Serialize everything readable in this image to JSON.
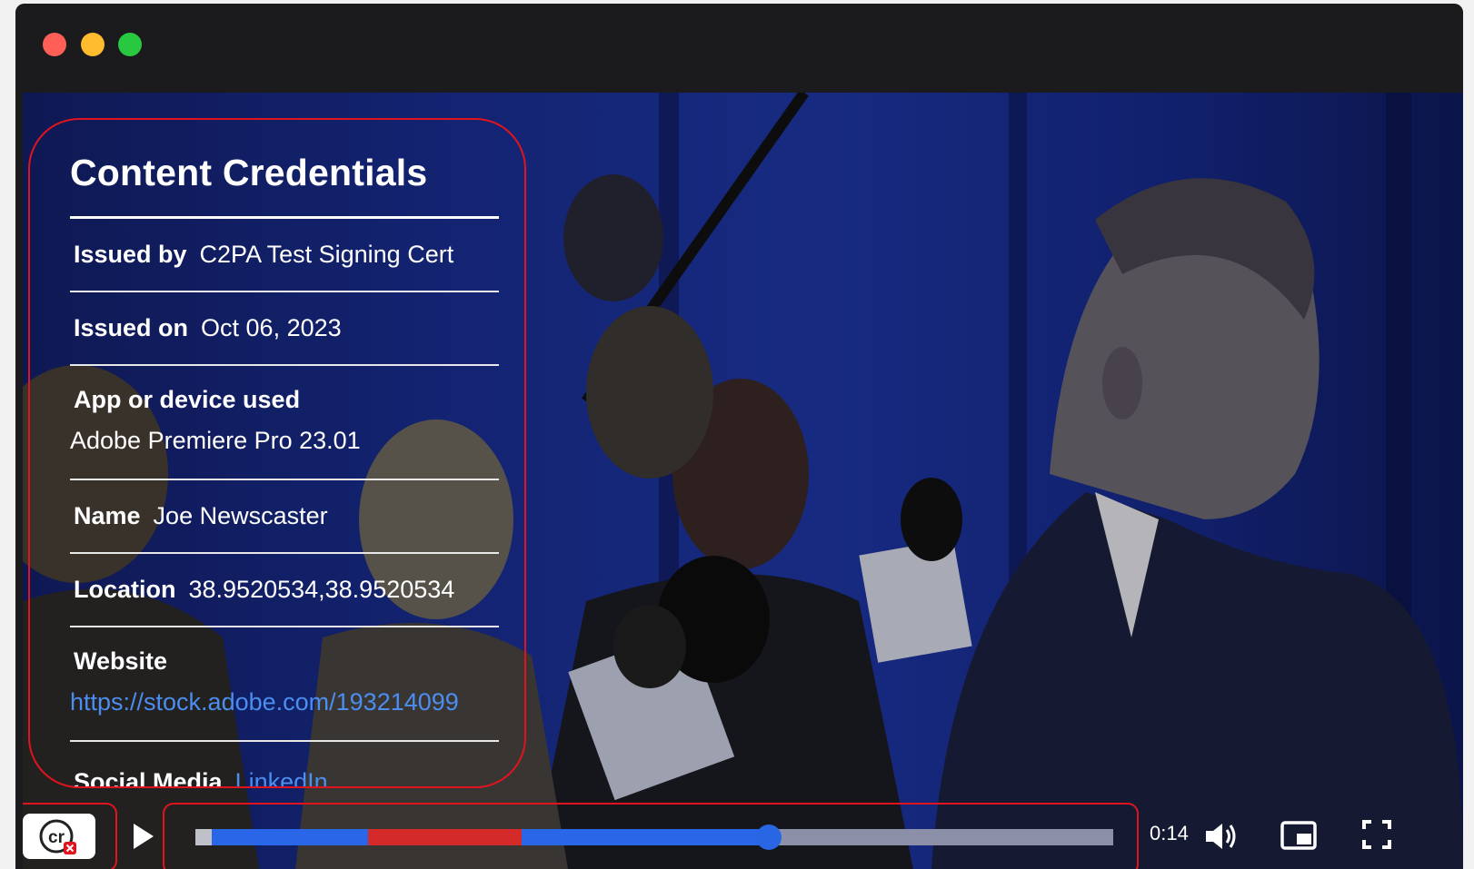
{
  "panel": {
    "title": "Content Credentials",
    "issued_by_label": "Issued by",
    "issued_by_value": "C2PA Test Signing Cert",
    "issued_on_label": "Issued on",
    "issued_on_value": "Oct 06, 2023",
    "app_label": "App or device used",
    "app_value": "Adobe Premiere Pro 23.01",
    "name_label": "Name",
    "name_value": "Joe Newscaster",
    "location_label": "Location",
    "location_value": "38.9520534,38.9520534",
    "website_label": "Website",
    "website_value": "https://stock.adobe.com/193214099",
    "social_label": "Social Media",
    "social_value": "LinkedIn"
  },
  "player": {
    "cr_badge": "cr",
    "time": "0:14",
    "progress_fraction": 0.625,
    "segments": [
      {
        "from": 0.0,
        "to": 0.018,
        "color": "#c0c0c8"
      },
      {
        "from": 0.018,
        "to": 0.188,
        "color": "#2a66e8"
      },
      {
        "from": 0.188,
        "to": 0.355,
        "color": "#d42a2a"
      },
      {
        "from": 0.355,
        "to": 0.625,
        "color": "#2a66e8"
      }
    ]
  },
  "colors": {
    "highlight": "#e0141e",
    "link": "#4b8ef0",
    "window": "#1b1b1d"
  }
}
